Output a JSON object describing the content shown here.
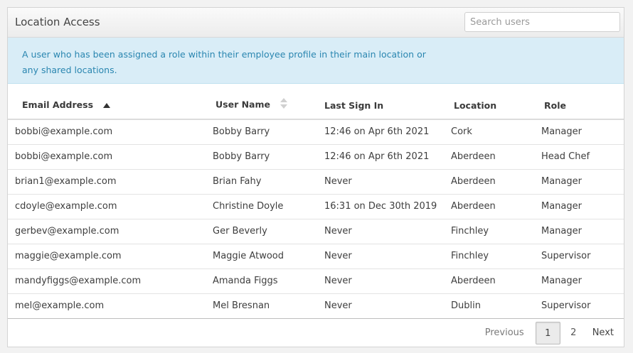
{
  "panel": {
    "title": "Location Access",
    "search_placeholder": "Search users"
  },
  "info": {
    "text": "A user who has been assigned a role within their employee profile in their main location or any shared locations."
  },
  "table": {
    "columns": [
      "Email Address",
      "User Name",
      "Last Sign In",
      "Location",
      "Role"
    ],
    "sort": {
      "column": "Email Address",
      "direction": "ascending"
    },
    "rows": [
      {
        "email": "bobbi@example.com",
        "user": "Bobby Barry",
        "last_sign_in": "12:46 on Apr 6th 2021",
        "location": "Cork",
        "role": "Manager"
      },
      {
        "email": "bobbi@example.com",
        "user": "Bobby Barry",
        "last_sign_in": "12:46 on Apr 6th 2021",
        "location": "Aberdeen",
        "role": "Head Chef"
      },
      {
        "email": "brian1@example.com",
        "user": "Brian Fahy",
        "last_sign_in": "Never",
        "location": "Aberdeen",
        "role": "Manager"
      },
      {
        "email": "cdoyle@example.com",
        "user": "Christine Doyle",
        "last_sign_in": "16:31 on Dec 30th 2019",
        "location": "Aberdeen",
        "role": "Manager"
      },
      {
        "email": "gerbev@example.com",
        "user": "Ger Beverly",
        "last_sign_in": "Never",
        "location": "Finchley",
        "role": "Manager"
      },
      {
        "email": "maggie@example.com",
        "user": "Maggie Atwood",
        "last_sign_in": "Never",
        "location": "Finchley",
        "role": "Supervisor"
      },
      {
        "email": "mandyfiggs@example.com",
        "user": "Amanda Figgs",
        "last_sign_in": "Never",
        "location": "Aberdeen",
        "role": "Manager"
      },
      {
        "email": "mel@example.com",
        "user": "Mel Bresnan",
        "last_sign_in": "Never",
        "location": "Dublin",
        "role": "Supervisor"
      }
    ]
  },
  "pagination": {
    "previous_label": "Previous",
    "pages": [
      "1",
      "2"
    ],
    "current_page": "1",
    "next_label": "Next"
  },
  "colors": {
    "info_background": "#d9edf7",
    "info_text": "#2a86b0"
  },
  "icons": {
    "sort_ascending": "caret-up-icon",
    "sortable": "sort-both-icon"
  }
}
